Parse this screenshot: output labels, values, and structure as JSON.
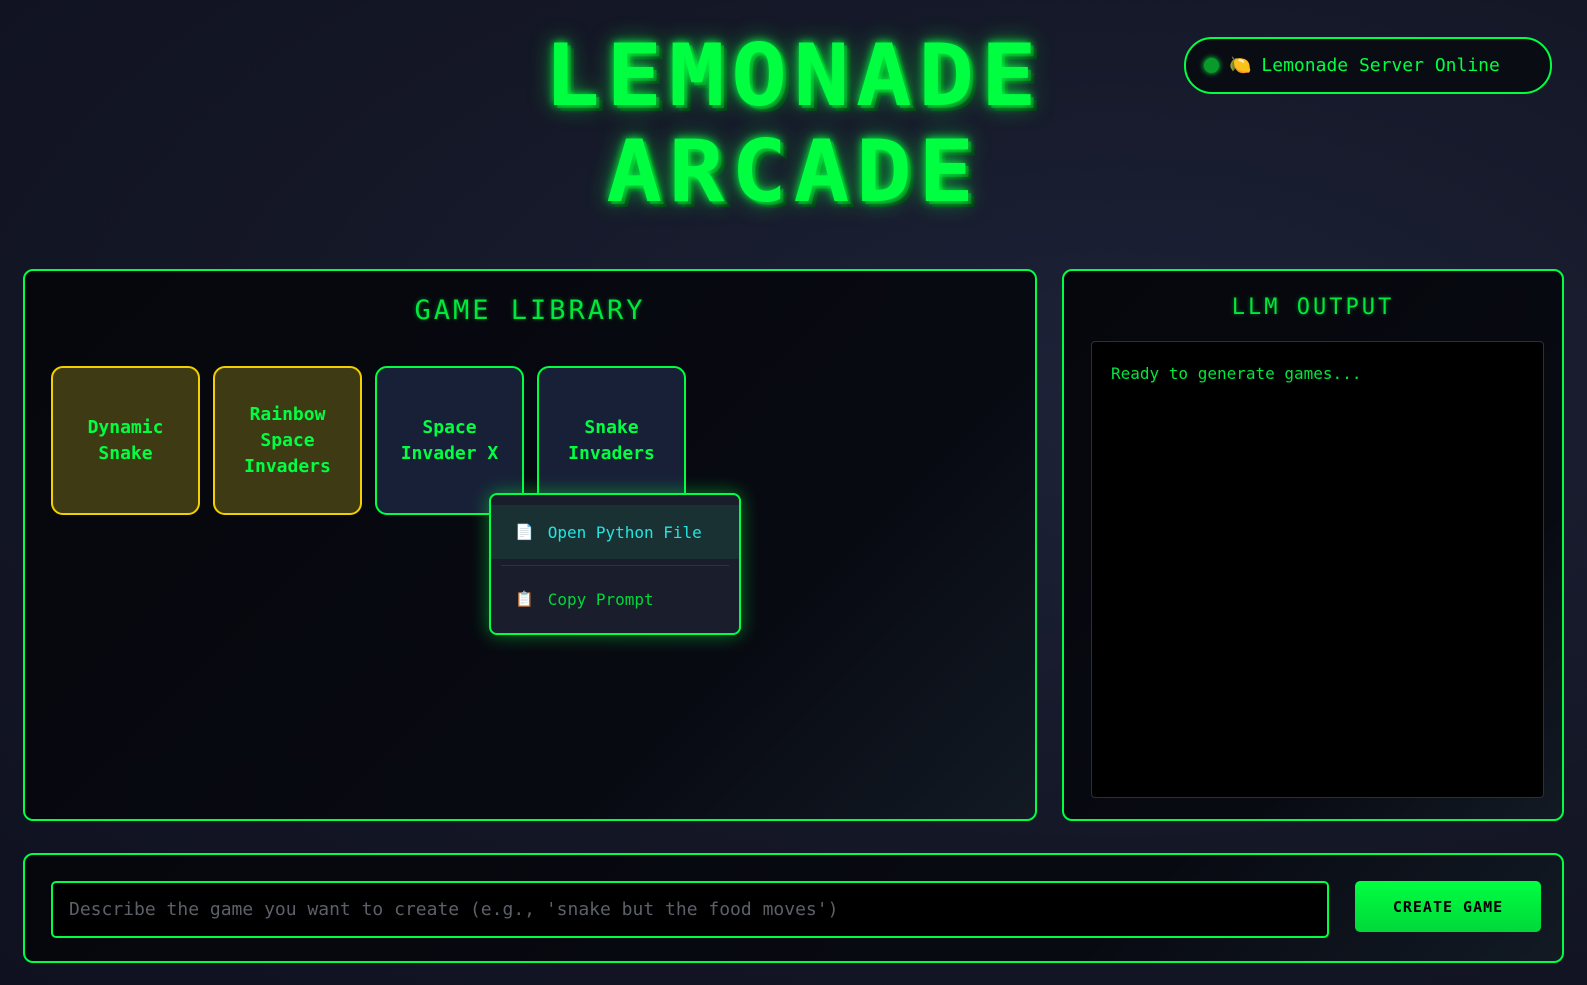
{
  "header": {
    "title_line1": "LEMONADE",
    "title_line2": "ARCADE",
    "status_icon": "🍋",
    "status_text": "Lemonade Server Online"
  },
  "library": {
    "title": "GAME LIBRARY",
    "games": [
      {
        "name": "Dynamic Snake",
        "style": "yellow"
      },
      {
        "name": "Rainbow Space Invaders",
        "style": "yellow"
      },
      {
        "name": "Space Invader X",
        "style": "green"
      },
      {
        "name": "Snake Invaders",
        "style": "green"
      }
    ]
  },
  "context_menu": {
    "items": [
      {
        "icon": "📄",
        "label": "Open Python File"
      },
      {
        "icon": "📋",
        "label": "Copy Prompt"
      }
    ]
  },
  "output": {
    "title": "LLM OUTPUT",
    "text": "Ready to generate games..."
  },
  "create": {
    "placeholder": "Describe the game you want to create (e.g., 'snake but the food moves')",
    "button_label": "CREATE GAME"
  },
  "colors": {
    "accent": "#00ff41",
    "yellow_border": "#f0d000",
    "menu_highlight": "#20e6e0"
  }
}
